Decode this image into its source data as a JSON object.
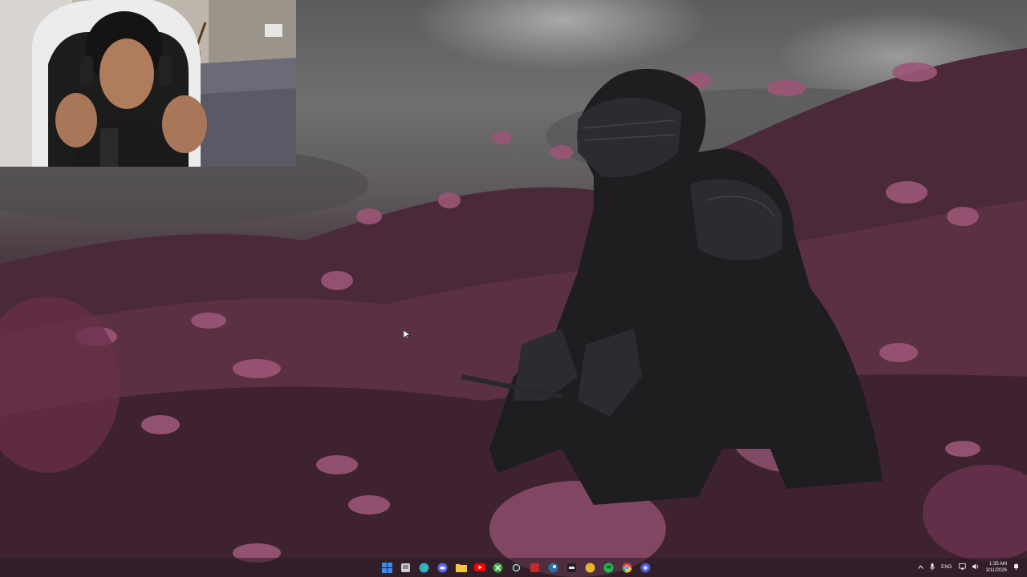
{
  "desktop": {
    "wallpaper": "armored-knight-kneeling-in-pink-flower-field",
    "colors": {
      "sky": "#6a6a6a",
      "flowers": "#8a4a64",
      "armor": "#1f1f22"
    }
  },
  "webcam_overlay": {
    "subject": "person-with-headset-in-bedroom"
  },
  "taskbar": {
    "pinned": [
      {
        "name": "start",
        "icon": "windows-icon",
        "color": "#3a8df0"
      },
      {
        "name": "search",
        "icon": "search-icon",
        "color": "#cfcfcf"
      },
      {
        "name": "edge",
        "icon": "edge-icon",
        "color": "#2fa7d8"
      },
      {
        "name": "discord",
        "icon": "discord-icon",
        "color": "#5865f2"
      },
      {
        "name": "file-explorer",
        "icon": "folder-icon",
        "color": "#f5c542"
      },
      {
        "name": "youtube",
        "icon": "youtube-icon",
        "color": "#ff0000"
      },
      {
        "name": "xbox",
        "icon": "xbox-icon",
        "color": "#3aa53a"
      },
      {
        "name": "obs",
        "icon": "obs-icon",
        "color": "#d8d8d8"
      },
      {
        "name": "app-red",
        "icon": "app-icon",
        "color": "#c62a2a"
      },
      {
        "name": "steam",
        "icon": "steam-icon",
        "color": "#2a6fa8"
      },
      {
        "name": "app-black",
        "icon": "app-icon",
        "color": "#202020"
      },
      {
        "name": "app-yellow",
        "icon": "app-icon",
        "color": "#e5b52a"
      },
      {
        "name": "spotify",
        "icon": "spotify-icon",
        "color": "#1db954"
      },
      {
        "name": "chrome",
        "icon": "chrome-icon",
        "color": "#e8453c"
      },
      {
        "name": "app-blue",
        "icon": "app-icon",
        "color": "#4a5ad8"
      }
    ],
    "tray": {
      "language": "ENG",
      "time": "1:35 AM",
      "date": "3/11/2026"
    }
  }
}
